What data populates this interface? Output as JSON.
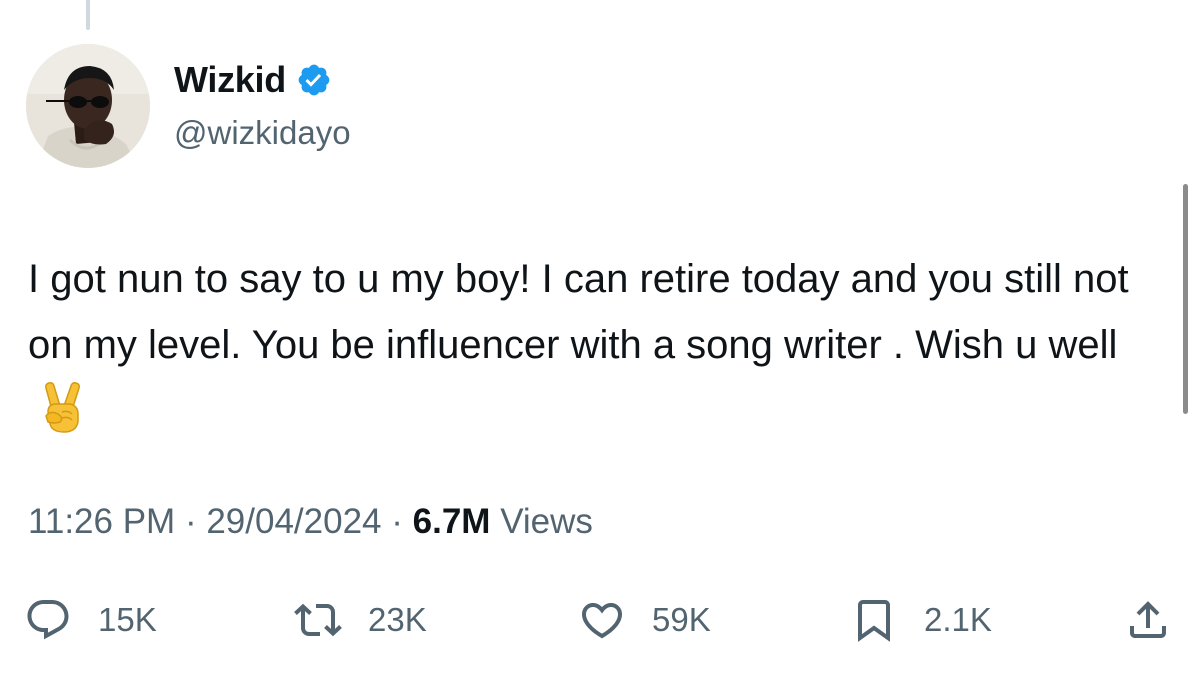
{
  "author": {
    "display_name": "Wizkid",
    "handle": "@wizkidayo",
    "verified": true,
    "verified_color": "#1d9bf0"
  },
  "tweet": {
    "text": "I got nun to say to u my boy! I can retire today and you still not on my level. You be influencer with a song writer . Wish u well",
    "emoji": "victory-hand-emoji"
  },
  "meta": {
    "time": "11:26 PM",
    "separator": "·",
    "date": "29/04/2024",
    "views_count": "6.7M",
    "views_label": "Views"
  },
  "actions": {
    "replies": "15K",
    "retweets": "23K",
    "likes": "59K",
    "bookmarks": "2.1K",
    "icons": [
      "reply-icon",
      "retweet-icon",
      "like-icon",
      "bookmark-icon",
      "share-icon"
    ]
  },
  "colors": {
    "text_primary": "#0f1419",
    "text_secondary": "#536471",
    "background": "#ffffff"
  }
}
